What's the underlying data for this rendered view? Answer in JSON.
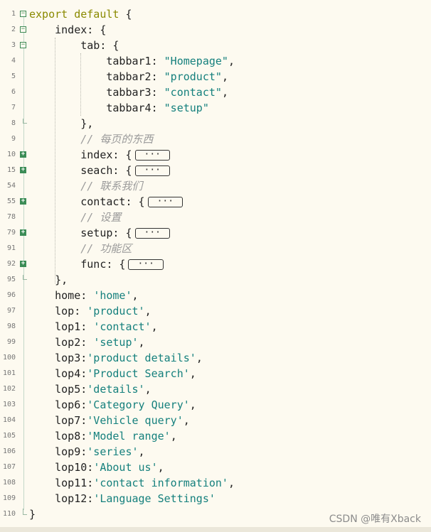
{
  "lines": [
    {
      "n": "1",
      "fold": "open",
      "parts": [
        {
          "t": "export default",
          "c": "kw"
        },
        {
          "t": " {"
        }
      ]
    },
    {
      "n": "2",
      "fold": "open",
      "parts": [
        {
          "t": "    index: {"
        }
      ]
    },
    {
      "n": "3",
      "fold": "open",
      "parts": [
        {
          "t": "        tab: {"
        }
      ]
    },
    {
      "n": "4",
      "fold": "",
      "parts": [
        {
          "t": "            tabbar1: "
        },
        {
          "t": "\"Homepage\"",
          "c": "str"
        },
        {
          "t": ","
        }
      ]
    },
    {
      "n": "5",
      "fold": "",
      "parts": [
        {
          "t": "            tabbar2: "
        },
        {
          "t": "\"product\"",
          "c": "str"
        },
        {
          "t": ","
        }
      ]
    },
    {
      "n": "6",
      "fold": "",
      "parts": [
        {
          "t": "            tabbar3: "
        },
        {
          "t": "\"contact\"",
          "c": "str"
        },
        {
          "t": ","
        }
      ]
    },
    {
      "n": "7",
      "fold": "",
      "parts": [
        {
          "t": "            tabbar4: "
        },
        {
          "t": "\"setup\"",
          "c": "str"
        }
      ]
    },
    {
      "n": "8",
      "fold": "end",
      "parts": [
        {
          "t": "        },"
        }
      ]
    },
    {
      "n": "9",
      "fold": "",
      "parts": [
        {
          "t": "        // 每页的东西",
          "c": "cm"
        }
      ]
    },
    {
      "n": "10",
      "fold": "closed",
      "parts": [
        {
          "t": "        index: {"
        }
      ],
      "collapsed": "···"
    },
    {
      "n": "15",
      "fold": "closed",
      "parts": [
        {
          "t": "        seach: {"
        }
      ],
      "collapsed": "···"
    },
    {
      "n": "54",
      "fold": "",
      "parts": [
        {
          "t": "        // 联系我们",
          "c": "cm"
        }
      ]
    },
    {
      "n": "55",
      "fold": "closed",
      "parts": [
        {
          "t": "        contact: {"
        }
      ],
      "collapsed": "···"
    },
    {
      "n": "78",
      "fold": "",
      "parts": [
        {
          "t": "        // 设置",
          "c": "cm"
        }
      ]
    },
    {
      "n": "79",
      "fold": "closed",
      "parts": [
        {
          "t": "        setup: {"
        }
      ],
      "collapsed": "···"
    },
    {
      "n": "91",
      "fold": "",
      "parts": [
        {
          "t": "        // 功能区",
          "c": "cm"
        }
      ]
    },
    {
      "n": "92",
      "fold": "closed",
      "parts": [
        {
          "t": "        func: {"
        }
      ],
      "collapsed": "···"
    },
    {
      "n": "95",
      "fold": "end",
      "parts": [
        {
          "t": "    },"
        }
      ]
    },
    {
      "n": "96",
      "fold": "",
      "parts": [
        {
          "t": "    home: "
        },
        {
          "t": "'home'",
          "c": "str"
        },
        {
          "t": ","
        }
      ]
    },
    {
      "n": "97",
      "fold": "",
      "parts": [
        {
          "t": "    lop: "
        },
        {
          "t": "'product'",
          "c": "str"
        },
        {
          "t": ","
        }
      ]
    },
    {
      "n": "98",
      "fold": "",
      "parts": [
        {
          "t": "    lop1: "
        },
        {
          "t": "'contact'",
          "c": "str"
        },
        {
          "t": ","
        }
      ]
    },
    {
      "n": "99",
      "fold": "",
      "parts": [
        {
          "t": "    lop2: "
        },
        {
          "t": "'setup'",
          "c": "str"
        },
        {
          "t": ","
        }
      ]
    },
    {
      "n": "100",
      "fold": "",
      "parts": [
        {
          "t": "    lop3:"
        },
        {
          "t": "'product details'",
          "c": "str"
        },
        {
          "t": ","
        }
      ]
    },
    {
      "n": "101",
      "fold": "",
      "parts": [
        {
          "t": "    lop4:"
        },
        {
          "t": "'Product Search'",
          "c": "str"
        },
        {
          "t": ","
        }
      ]
    },
    {
      "n": "102",
      "fold": "",
      "parts": [
        {
          "t": "    lop5:"
        },
        {
          "t": "'details'",
          "c": "str"
        },
        {
          "t": ","
        }
      ]
    },
    {
      "n": "103",
      "fold": "",
      "parts": [
        {
          "t": "    lop6:"
        },
        {
          "t": "'Category Query'",
          "c": "str"
        },
        {
          "t": ","
        }
      ]
    },
    {
      "n": "104",
      "fold": "",
      "parts": [
        {
          "t": "    lop7:"
        },
        {
          "t": "'Vehicle query'",
          "c": "str"
        },
        {
          "t": ","
        }
      ]
    },
    {
      "n": "105",
      "fold": "",
      "parts": [
        {
          "t": "    lop8:"
        },
        {
          "t": "'Model range'",
          "c": "str"
        },
        {
          "t": ","
        }
      ]
    },
    {
      "n": "106",
      "fold": "",
      "parts": [
        {
          "t": "    lop9:"
        },
        {
          "t": "'series'",
          "c": "str"
        },
        {
          "t": ","
        }
      ]
    },
    {
      "n": "107",
      "fold": "",
      "parts": [
        {
          "t": "    lop10:"
        },
        {
          "t": "'About us'",
          "c": "str"
        },
        {
          "t": ","
        }
      ]
    },
    {
      "n": "108",
      "fold": "",
      "parts": [
        {
          "t": "    lop11:"
        },
        {
          "t": "'contact information'",
          "c": "str"
        },
        {
          "t": ","
        }
      ]
    },
    {
      "n": "109",
      "fold": "",
      "parts": [
        {
          "t": "    lop12:"
        },
        {
          "t": "'Language Settings'",
          "c": "str"
        }
      ]
    },
    {
      "n": "110",
      "fold": "final",
      "parts": [
        {
          "t": "}"
        }
      ]
    }
  ],
  "watermark": "CSDN @唯有Xback",
  "colors": {
    "background": "#fdfaf0",
    "keyword": "#8a8a00",
    "string": "#15807d",
    "comment": "#9a9a9a",
    "fold_marker": "#3b8c56"
  },
  "icons": {
    "fold_open": "minus-box-icon",
    "fold_closed": "plus-box-icon",
    "collapsed_block": "ellipsis-box"
  }
}
